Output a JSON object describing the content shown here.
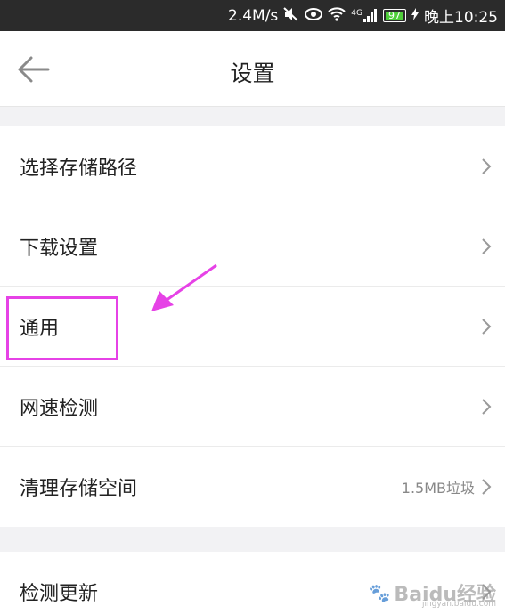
{
  "status_bar": {
    "speed": "2.4M/s",
    "network": "4G",
    "battery": "97",
    "time": "晚上10:25"
  },
  "header": {
    "title": "设置"
  },
  "settings": [
    {
      "label": "选择存储路径"
    },
    {
      "label": "下载设置"
    },
    {
      "label": "通用"
    },
    {
      "label": "网速检测"
    },
    {
      "label": "清理存储空间",
      "value": "1.5MB垃圾"
    },
    {
      "label": "检测更新"
    }
  ],
  "watermark": {
    "brand": "Baidu经验",
    "url": "jingyan.baidu.com"
  },
  "colors": {
    "status_bar_bg": "#2b2b2b",
    "annotation": "#e642e6",
    "battery_fill": "#4fce3a",
    "section_gap": "#f2f2f4"
  }
}
